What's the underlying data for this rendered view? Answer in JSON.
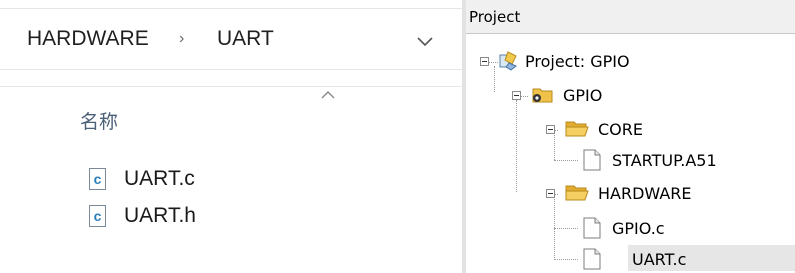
{
  "explorer": {
    "breadcrumb": [
      "HARDWARE",
      "UART"
    ],
    "breadcrumb_separator": "›",
    "column_header": "名称",
    "files": [
      {
        "name": "UART.c",
        "icon": "c-source-file-icon"
      },
      {
        "name": "UART.h",
        "icon": "c-source-file-icon"
      }
    ]
  },
  "project": {
    "panel_title": "Project",
    "tree": {
      "root": "Project: GPIO",
      "target": "GPIO",
      "groups": [
        {
          "name": "CORE",
          "files": [
            "STARTUP.A51"
          ]
        },
        {
          "name": "HARDWARE",
          "files": [
            "GPIO.c",
            "UART.c"
          ]
        }
      ],
      "selected_file": "UART.c"
    }
  },
  "colors": {
    "folder": "#f0c24a",
    "c_icon": "#2b7fb8",
    "selection": "#e6e6e6",
    "header_bg": "#f0f0f0"
  }
}
